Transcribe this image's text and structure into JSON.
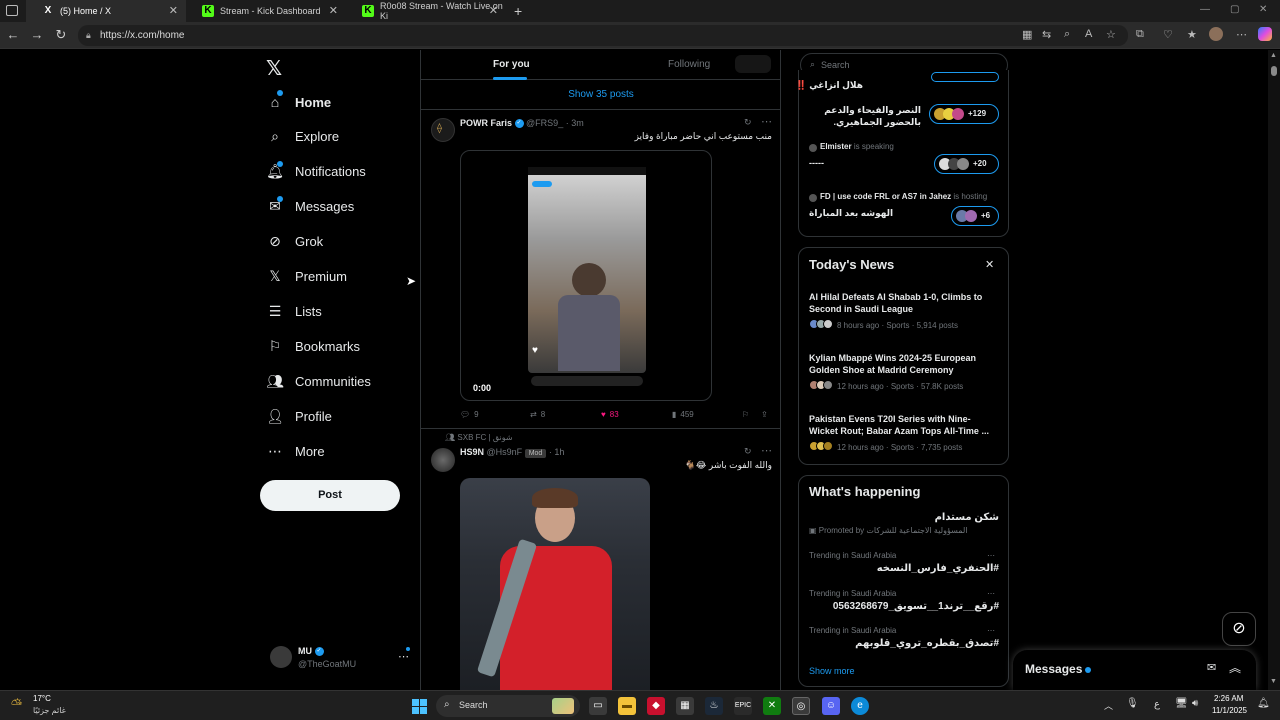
{
  "browser": {
    "tabs": [
      {
        "title": "(5) Home / X",
        "favicon": "X"
      },
      {
        "title": "Stream - Kick Dashboard",
        "favicon": "K"
      },
      {
        "title": "R0o08 Stream - Watch Live on Ki",
        "favicon": "K"
      }
    ],
    "url": "https://x.com/home"
  },
  "nav": {
    "items": [
      {
        "label": "Home",
        "icon": "home-icon"
      },
      {
        "label": "Explore",
        "icon": "search-icon"
      },
      {
        "label": "Notifications",
        "icon": "bell-icon"
      },
      {
        "label": "Messages",
        "icon": "mail-icon"
      },
      {
        "label": "Grok",
        "icon": "grok-icon"
      },
      {
        "label": "Premium",
        "icon": "x-icon"
      },
      {
        "label": "Lists",
        "icon": "list-icon"
      },
      {
        "label": "Bookmarks",
        "icon": "bookmark-icon"
      },
      {
        "label": "Communities",
        "icon": "people-icon"
      },
      {
        "label": "Profile",
        "icon": "person-icon"
      },
      {
        "label": "More",
        "icon": "more-icon"
      }
    ],
    "post_label": "Post",
    "account": {
      "name": "MU",
      "handle": "@TheGoatMU"
    }
  },
  "feed": {
    "tab_for_you": "For you",
    "tab_following": "Following",
    "show_posts": "Show 35 posts",
    "post1": {
      "name": "POWR Faris",
      "handle": "@FRS9_",
      "time": "· 3m",
      "text": "منب مستوعب اني حاضر مباراة وفايز",
      "video_time": "0:00",
      "replies": "9",
      "reposts": "8",
      "likes": "83",
      "views": "459"
    },
    "post2": {
      "community": "SXB FC | شونق",
      "name": "HS9N",
      "handle": "@Hs9nF",
      "badge": "Mod",
      "time": "· 1h",
      "text": "والله الفوت باشر 😂🐐"
    }
  },
  "right": {
    "search_placeholder": "Search",
    "spaces": [
      {
        "title": "هلال انزاغي ‼️",
        "host": "",
        "count": ""
      },
      {
        "title": "النصر والفيحاء والدعم بالحضور الجماهيري.",
        "host": "",
        "count": "+129"
      },
      {
        "title": "-----",
        "host": "Elmister",
        "status": "is speaking",
        "count": "+20"
      },
      {
        "title": "الهوشه بعد المباراة",
        "host": "FD | use code FRL or AS7 in Jahez",
        "status": "is hosting",
        "count": "+6"
      }
    ],
    "news_heading": "Today's News",
    "news": [
      {
        "title": "Al Hilal Defeats Al Shabab 1-0, Climbs to Second in Saudi League",
        "meta": "8 hours ago · Sports · 5,914 posts"
      },
      {
        "title": "Kylian Mbappé Wins 2024-25 European Golden Shoe at Madrid Ceremony",
        "meta": "12 hours ago · Sports · 57.8K posts"
      },
      {
        "title": "Pakistan Evens T20I Series with Nine-Wicket Rout; Babar Azam Tops All-Time ...",
        "meta": "12 hours ago · Sports · 7,735 posts"
      }
    ],
    "happening_heading": "What's happening",
    "promoted": {
      "title": "شكن مستدام",
      "subtitle": "المسؤولية الاجتماعية للشركات",
      "label": "Promoted by"
    },
    "trends": [
      {
        "context": "Trending in Saudi Arabia",
        "title": "#الحنفري_فارس_النسخه"
      },
      {
        "context": "Trending in Saudi Arabia",
        "title": "#رقع__ترند1__تسويق_0563268679"
      },
      {
        "context": "Trending in Saudi Arabia",
        "title": "#تصدق_بقطره_تروي_قلوبهم"
      }
    ],
    "show_more": "Show more",
    "messages_label": "Messages"
  },
  "taskbar": {
    "weather_temp": "17°C",
    "weather_desc": "غائم جزئيًا",
    "search_label": "Search",
    "time": "2:26 AM",
    "date": "11/1/2025",
    "lang": "ع"
  },
  "colors": {
    "accent": "#1d9bf0",
    "like": "#f91880",
    "bg": "#000000",
    "border": "#2f3336"
  }
}
